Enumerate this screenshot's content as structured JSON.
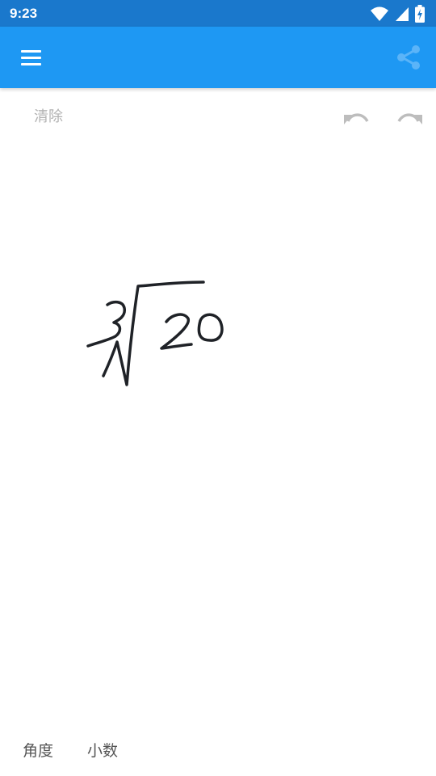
{
  "status_bar": {
    "time": "9:23",
    "icons": [
      "wifi-icon",
      "cellular-signal-icon",
      "battery-charging-icon"
    ]
  },
  "app_bar": {
    "color": "#1e98f3",
    "menu_icon": "hamburger-menu-icon",
    "share_icon": "share-icon"
  },
  "toolbar": {
    "clear_label": "清除",
    "undo_icon": "undo-icon",
    "redo_icon": "redo-icon"
  },
  "canvas": {
    "handwriting_description_icon": "handwritten-expression",
    "ink_color": "#1f2227"
  },
  "bottom_options": {
    "angle_label": "角度",
    "decimal_label": "小数"
  }
}
